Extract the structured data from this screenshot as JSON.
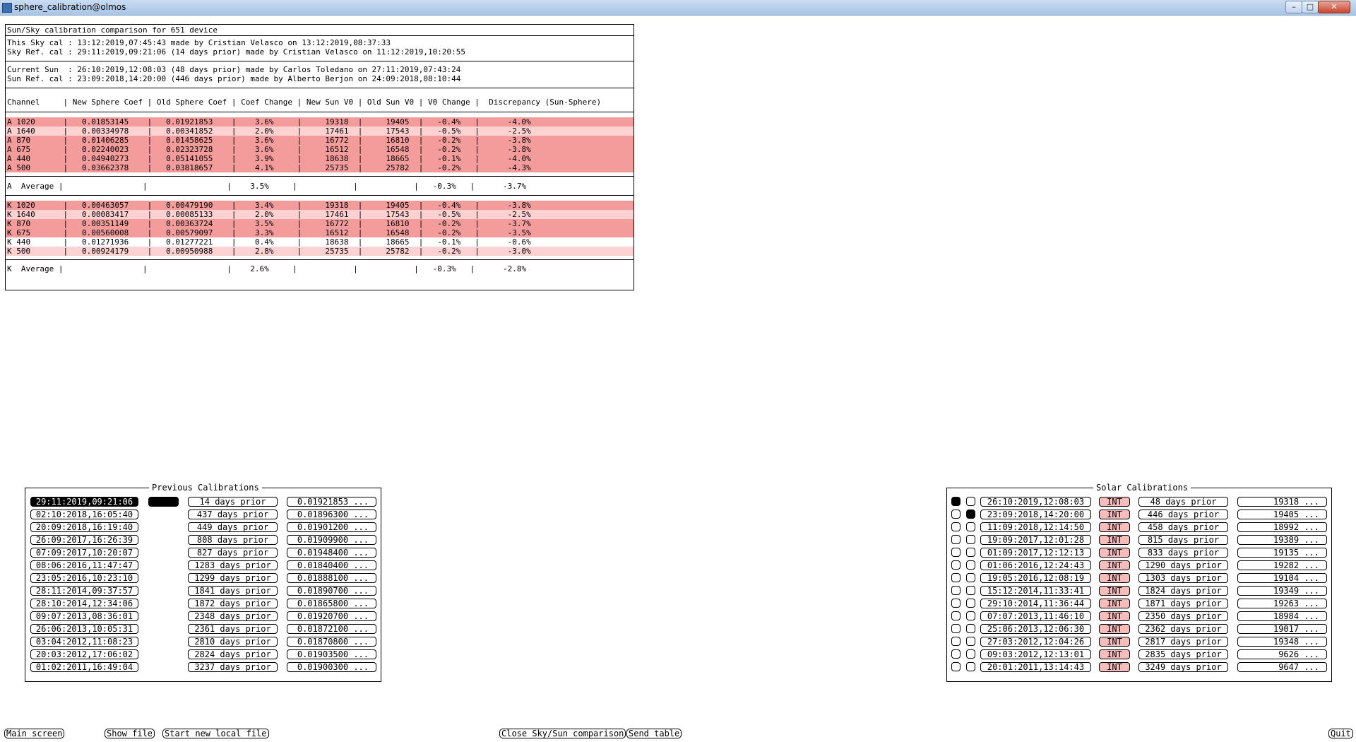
{
  "window": {
    "title": "sphere_calibration@olmos"
  },
  "comparison": {
    "title": "Sun/Sky calibration comparison for 651 device",
    "sky_this": "This Sky cal : 13:12:2019,07:45:43 made by Cristian Velasco on 13:12:2019,08:37:33",
    "sky_ref": "Sky Ref. cal : 29:11:2019,09:21:06 (14 days prior) made by Cristian Velasco on 11:12:2019,10:20:55",
    "sun_current": "Current Sun  : 26:10:2019,12:08:03 (48 days prior) made by Carlos Toledano on 27:11:2019,07:43:24",
    "sun_ref": "Sun Ref. cal : 23:09:2018,14:20:00 (446 days prior) made by Alberto Berjon on 24:09:2018,08:10:44",
    "header": "Channel     | New Sphere Coef | Old Sphere Coef | Coef Change | New Sun V0 | Old Sun V0 | V0 Change |  Discrepancy (Sun-Sphere)",
    "a_rows": [
      {
        "text": "A 1020      |   0.01853145    |   0.01921853    |    3.6%     |     19318  |     19405  |   -0.4%   |      -4.0%",
        "shade": "strong"
      },
      {
        "text": "A 1640      |   0.00334978    |   0.00341852    |    2.0%     |     17461  |     17543  |   -0.5%   |      -2.5%",
        "shade": "light"
      },
      {
        "text": "A 870       |   0.01406285    |   0.01458625    |    3.6%     |     16772  |     16810  |   -0.2%   |      -3.8%",
        "shade": "strong"
      },
      {
        "text": "A 675       |   0.02240023    |   0.02323728    |    3.6%     |     16512  |     16548  |   -0.2%   |      -3.8%",
        "shade": "strong"
      },
      {
        "text": "A 440       |   0.04940273    |   0.05141055    |    3.9%     |     18638  |     18665  |   -0.1%   |      -4.0%",
        "shade": "strong"
      },
      {
        "text": "A 500       |   0.03662378    |   0.03818657    |    4.1%     |     25735  |     25782  |   -0.2%   |      -4.3%",
        "shade": "strong"
      }
    ],
    "a_average": "A  Average |                 |                 |    3.5%     |            |            |   -0.3%   |      -3.7%",
    "k_rows": [
      {
        "text": "K 1020      |   0.00463057    |   0.00479190    |    3.4%     |     19318  |     19405  |   -0.4%   |      -3.8%",
        "shade": "strong"
      },
      {
        "text": "K 1640      |   0.00083417    |   0.00085133    |    2.0%     |     17461  |     17543  |   -0.5%   |      -2.5%",
        "shade": "light"
      },
      {
        "text": "K 870       |   0.00351149    |   0.00363724    |    3.5%     |     16772  |     16810  |   -0.2%   |      -3.7%",
        "shade": "strong"
      },
      {
        "text": "K 675       |   0.00560008    |   0.00579097    |    3.3%     |     16512  |     16548  |   -0.2%   |      -3.5%",
        "shade": "strong"
      },
      {
        "text": "K 440       |   0.01271936    |   0.01277221    |    0.4%     |     18638  |     18665  |   -0.1%   |      -0.6%",
        "shade": "none"
      },
      {
        "text": "K 500       |   0.00924179    |   0.00950988    |    2.8%     |     25735  |     25782  |   -0.2%   |      -3.0%",
        "shade": "light"
      }
    ],
    "k_average": "K  Average |                 |                 |    2.6%     |            |            |   -0.3%   |      -2.8%",
    "colors": {
      "strong": "#f49c9c",
      "light": "#fbd1d1"
    }
  },
  "previous_calibrations": {
    "legend": "Previous Calibrations",
    "rows": [
      {
        "date": "29:11:2019,09:21:06",
        "prior": "14 days prior",
        "coef": "0.01921853 ...",
        "selected": true
      },
      {
        "date": "02:10:2018,16:05:40",
        "prior": "437 days prior",
        "coef": "0.01896300 ...",
        "selected": false
      },
      {
        "date": "20:09:2018,16:19:40",
        "prior": "449 days prior",
        "coef": "0.01901200 ...",
        "selected": false
      },
      {
        "date": "26:09:2017,16:26:39",
        "prior": "808 days prior",
        "coef": "0.01909900 ...",
        "selected": false
      },
      {
        "date": "07:09:2017,10:20:07",
        "prior": "827 days prior",
        "coef": "0.01948400 ...",
        "selected": false
      },
      {
        "date": "08:06:2016,11:47:47",
        "prior": "1283 days prior",
        "coef": "0.01840400 ...",
        "selected": false
      },
      {
        "date": "23:05:2016,10:23:10",
        "prior": "1299 days prior",
        "coef": "0.01888100 ...",
        "selected": false
      },
      {
        "date": "28:11:2014,09:37:57",
        "prior": "1841 days prior",
        "coef": "0.01890700 ...",
        "selected": false
      },
      {
        "date": "28:10:2014,12:34:06",
        "prior": "1872 days prior",
        "coef": "0.01865800 ...",
        "selected": false
      },
      {
        "date": "09:07:2013,08:36:01",
        "prior": "2348 days prior",
        "coef": "0.01920700 ...",
        "selected": false
      },
      {
        "date": "26:06:2013,10:05:31",
        "prior": "2361 days prior",
        "coef": "0.01872100 ...",
        "selected": false
      },
      {
        "date": "03:04:2012,11:08:23",
        "prior": "2810 days prior",
        "coef": "0.01870800 ...",
        "selected": false
      },
      {
        "date": "20:03:2012,17:06:02",
        "prior": "2824 days prior",
        "coef": "0.01903500 ...",
        "selected": false
      },
      {
        "date": "01:02:2011,16:49:04",
        "prior": "3237 days prior",
        "coef": "0.01900300 ...",
        "selected": false
      }
    ]
  },
  "solar_calibrations": {
    "legend": "Solar Calibrations",
    "int_label": "INT",
    "rows": [
      {
        "date": "26:10:2019,12:08:03",
        "prior": "48 days prior",
        "v0": "19318 ...",
        "sel1": true,
        "sel2": false
      },
      {
        "date": "23:09:2018,14:20:00",
        "prior": "446 days prior",
        "v0": "19405 ...",
        "sel1": false,
        "sel2": true
      },
      {
        "date": "11:09:2018,12:14:50",
        "prior": "458 days prior",
        "v0": "18992 ...",
        "sel1": false,
        "sel2": false
      },
      {
        "date": "19:09:2017,12:01:28",
        "prior": "815 days prior",
        "v0": "19389 ...",
        "sel1": false,
        "sel2": false
      },
      {
        "date": "01:09:2017,12:12:13",
        "prior": "833 days prior",
        "v0": "19135 ...",
        "sel1": false,
        "sel2": false
      },
      {
        "date": "01:06:2016,12:24:43",
        "prior": "1290 days prior",
        "v0": "19282 ...",
        "sel1": false,
        "sel2": false
      },
      {
        "date": "19:05:2016,12:08:19",
        "prior": "1303 days prior",
        "v0": "19104 ...",
        "sel1": false,
        "sel2": false
      },
      {
        "date": "15:12:2014,11:33:41",
        "prior": "1824 days prior",
        "v0": "19349 ...",
        "sel1": false,
        "sel2": false
      },
      {
        "date": "29:10:2014,11:36:44",
        "prior": "1871 days prior",
        "v0": "19263 ...",
        "sel1": false,
        "sel2": false
      },
      {
        "date": "07:07:2013,11:46:10",
        "prior": "2350 days prior",
        "v0": "18984 ...",
        "sel1": false,
        "sel2": false
      },
      {
        "date": "25:06:2013,12:06:30",
        "prior": "2362 days prior",
        "v0": "19017 ...",
        "sel1": false,
        "sel2": false
      },
      {
        "date": "27:03:2012,12:04:26",
        "prior": "2817 days prior",
        "v0": "19348 ...",
        "sel1": false,
        "sel2": false
      },
      {
        "date": "09:03:2012,12:13:01",
        "prior": "2835 days prior",
        "v0": "9626 ...",
        "sel1": false,
        "sel2": false
      },
      {
        "date": "20:01:2011,13:14:43",
        "prior": "3249 days prior",
        "v0": "9647 ...",
        "sel1": false,
        "sel2": false
      }
    ]
  },
  "bottom_bar": {
    "main_screen": "Main screen",
    "show_file": "Show file",
    "start_new_local_file": "Start new local file",
    "close_comparison": "Close Sky/Sun comparison",
    "send_table": "Send table",
    "quit": "Quit"
  }
}
